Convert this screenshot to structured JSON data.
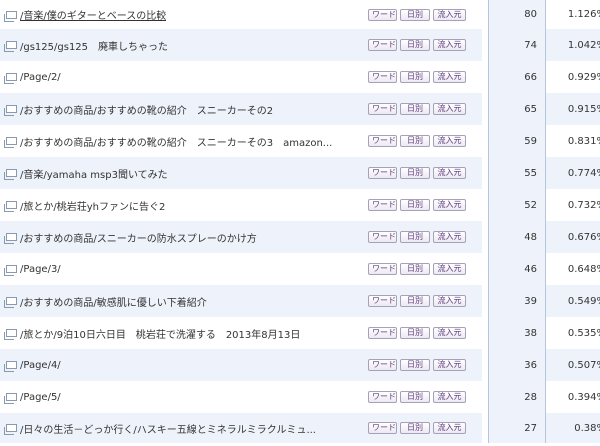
{
  "buttons": {
    "word": "ワード",
    "daily": "日別",
    "source": "流入元"
  },
  "rows": [
    {
      "page": "/音楽/僕のギターとベースの比較",
      "count": "80",
      "percent": "1.126%"
    },
    {
      "page": "/gs125/gs125　廃車しちゃった",
      "count": "74",
      "percent": "1.042%"
    },
    {
      "page": "/Page/2/",
      "count": "66",
      "percent": "0.929%"
    },
    {
      "page": "/おすすめの商品/おすすめの靴の紹介　スニーカーその2",
      "count": "65",
      "percent": "0.915%"
    },
    {
      "page": "/おすすめの商品/おすすめの靴の紹介　スニーカーその3　amazon...",
      "count": "59",
      "percent": "0.831%"
    },
    {
      "page": "/音楽/yamaha msp3聞いてみた",
      "count": "55",
      "percent": "0.774%"
    },
    {
      "page": "/旅とか/桃岩荘yhファンに告ぐ2",
      "count": "52",
      "percent": "0.732%"
    },
    {
      "page": "/おすすめの商品/スニーカーの防水スプレーのかけ方",
      "count": "48",
      "percent": "0.676%"
    },
    {
      "page": "/Page/3/",
      "count": "46",
      "percent": "0.648%"
    },
    {
      "page": "/おすすめの商品/敏感肌に優しい下着紹介",
      "count": "39",
      "percent": "0.549%"
    },
    {
      "page": "/旅とか/9泊10日六日目　桃岩荘で洗濯する　2013年8月13日",
      "count": "38",
      "percent": "0.535%"
    },
    {
      "page": "/Page/4/",
      "count": "36",
      "percent": "0.507%"
    },
    {
      "page": "/Page/5/",
      "count": "28",
      "percent": "0.394%"
    },
    {
      "page": "/日々の生活－どっか行く/ハスキー五線とミネラルミラクルミュ...",
      "count": "27",
      "percent": "0.38%"
    }
  ]
}
